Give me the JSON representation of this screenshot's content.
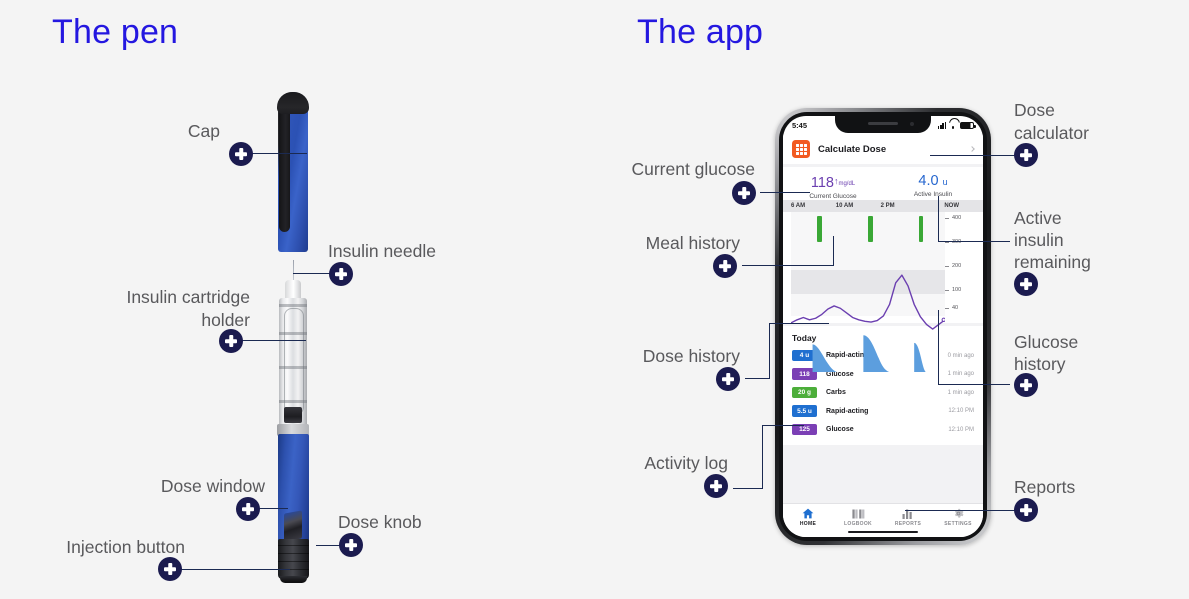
{
  "headings": {
    "pen": "The pen",
    "app": "The app"
  },
  "colors": {
    "heading": "#2417e0",
    "marker": "#1b1b4f",
    "leader": "#1b2a52",
    "label": "#59595c",
    "background": "#f4f4f4",
    "accent_orange": "#f25a21",
    "glucose_purple": "#6b3fb0",
    "insulin_blue": "#2566cf",
    "carb_green": "#3aa836"
  },
  "pen_callouts": [
    {
      "id": "cap",
      "label": "Cap"
    },
    {
      "id": "insulin-needle",
      "label": "Insulin needle"
    },
    {
      "id": "insulin-cartridge-holder",
      "label": "Insulin cartridge\nholder"
    },
    {
      "id": "dose-window",
      "label": "Dose window"
    },
    {
      "id": "dose-knob",
      "label": "Dose knob"
    },
    {
      "id": "injection-button",
      "label": "Injection button"
    }
  ],
  "app_callouts": [
    {
      "id": "current-glucose",
      "label": "Current glucose"
    },
    {
      "id": "meal-history",
      "label": "Meal history"
    },
    {
      "id": "dose-history",
      "label": "Dose history"
    },
    {
      "id": "activity-log",
      "label": "Activity log"
    },
    {
      "id": "dose-calculator",
      "label": "Dose\ncalculator"
    },
    {
      "id": "active-insulin-remaining",
      "label": "Active\ninsulin\nremaining"
    },
    {
      "id": "glucose-history",
      "label": "Glucose\nhistory"
    },
    {
      "id": "reports",
      "label": "Reports"
    }
  ],
  "phone": {
    "status": {
      "time": "5:45",
      "signal_icon": "cellular-signal-icon",
      "wifi_icon": "wifi-icon",
      "battery_icon": "battery-icon"
    },
    "header": {
      "icon": "calculator-icon",
      "title": "Calculate Dose",
      "chevron": "chevron-right-icon"
    },
    "stats": [
      {
        "id": "current-glucose",
        "value": "118",
        "arrow": "↑",
        "unit": "mg/dL",
        "label": "Current Glucose"
      },
      {
        "id": "active-insulin",
        "value": "4.0",
        "unit": "u",
        "label": "Active Insulin"
      }
    ],
    "today_label": "Today",
    "log_rows": [
      {
        "badge": "4 u",
        "badge_color": "#1f6fd0",
        "name": "Rapid-acting",
        "time": "0 min ago"
      },
      {
        "badge": "118",
        "badge_color": "#7b3fb5",
        "name": "Glucose",
        "time": "1 min ago"
      },
      {
        "badge": "20 g",
        "badge_color": "#4cae3a",
        "name": "Carbs",
        "time": "1 min ago"
      },
      {
        "badge": "5.5 u",
        "badge_color": "#1f6fd0",
        "name": "Rapid-acting",
        "time": "12:10 PM"
      },
      {
        "badge": "125",
        "badge_color": "#7b3fb5",
        "name": "Glucose",
        "time": "12:10 PM"
      }
    ],
    "tabs": [
      {
        "id": "home",
        "label": "HOME",
        "icon": "home-icon",
        "active": true
      },
      {
        "id": "logbook",
        "label": "LOGBOOK",
        "icon": "book-icon",
        "active": false
      },
      {
        "id": "reports",
        "label": "REPORTS",
        "icon": "bar-chart-icon",
        "active": false
      },
      {
        "id": "settings",
        "label": "SETTINGS",
        "icon": "gear-icon",
        "active": false
      }
    ]
  },
  "chart_data": {
    "type": "line",
    "title": "Glucose history",
    "xlabel": "",
    "ylabel": "mg/dL",
    "x_tick_labels": [
      "6 AM",
      "10 AM",
      "2 PM",
      "NOW"
    ],
    "y_tick_labels": [
      "400",
      "300",
      "200",
      "100",
      "40"
    ],
    "ylim": [
      40,
      400
    ],
    "grid": false,
    "legend_position": "none",
    "target_band": [
      70,
      180
    ],
    "series": [
      {
        "name": "Glucose",
        "type": "line",
        "color": "#6b3fb0",
        "x": [
          0,
          4,
          8,
          12,
          16,
          20,
          24,
          28,
          32,
          36,
          40,
          44,
          48,
          52,
          56,
          60,
          64,
          68,
          72,
          76,
          80,
          84,
          88,
          92,
          96,
          100
        ],
        "values": [
          112,
          118,
          122,
          116,
          120,
          128,
          140,
          148,
          142,
          132,
          122,
          116,
          112,
          110,
          114,
          124,
          150,
          192,
          210,
          185,
          150,
          126,
          108,
          100,
          108,
          118
        ]
      },
      {
        "name": "Meal history",
        "type": "bar",
        "color": "#3aa836",
        "x": [
          17,
          50,
          83
        ],
        "values": [
          400,
          400,
          400
        ]
      },
      {
        "name": "Dose history",
        "type": "area",
        "color": "#5c9ede",
        "x": [
          17,
          50,
          83
        ],
        "values": [
          4.0,
          5.5,
          4.0
        ]
      }
    ]
  }
}
